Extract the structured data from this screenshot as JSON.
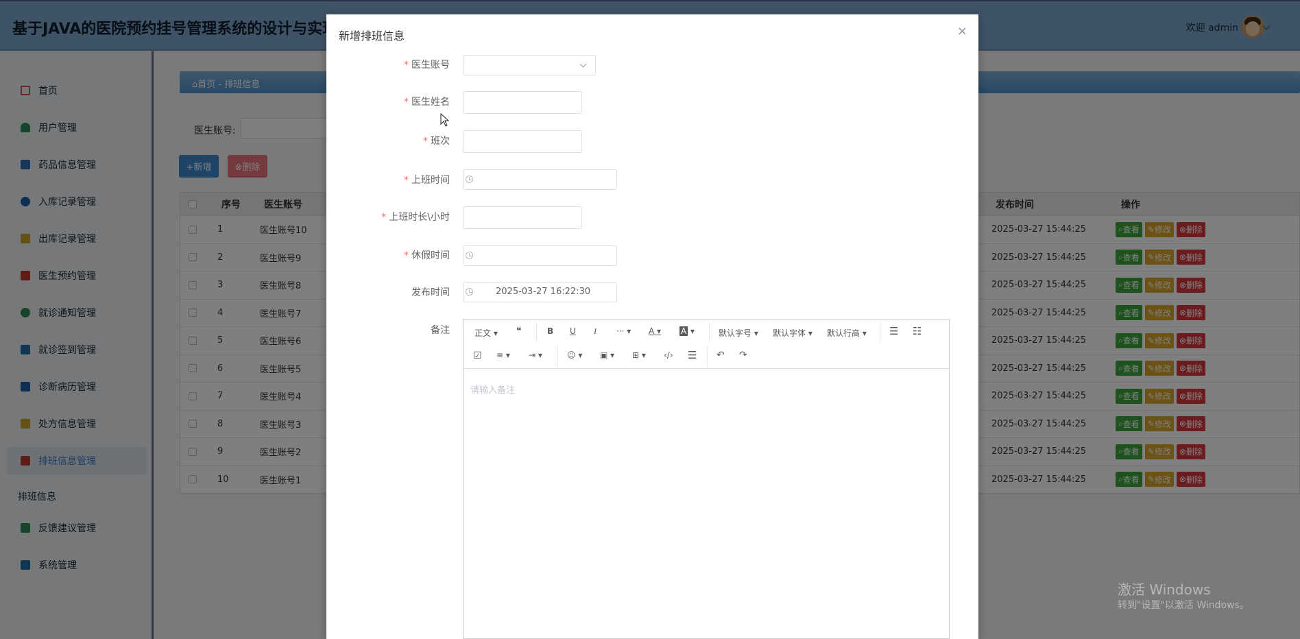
{
  "app": {
    "title": "基于JAVA的医院预约挂号管理系统的设计与实现",
    "welcome": "欢迎 admin"
  },
  "sidebar": {
    "items": [
      {
        "label": "首页",
        "icon": "home-icon",
        "color": "#d9534f"
      },
      {
        "label": "用户管理",
        "icon": "user-icon",
        "color": "#2e8b57"
      },
      {
        "label": "药品信息管理",
        "icon": "medicine-icon",
        "color": "#2a6fb0"
      },
      {
        "label": "入库记录管理",
        "icon": "stock-in-icon",
        "color": "#1f5fa8"
      },
      {
        "label": "出库记录管理",
        "icon": "stock-out-icon",
        "color": "#c9a227"
      },
      {
        "label": "医生预约管理",
        "icon": "appointment-icon",
        "color": "#c0392b"
      },
      {
        "label": "就诊通知管理",
        "icon": "notice-icon",
        "color": "#2e8b57"
      },
      {
        "label": "就诊签到管理",
        "icon": "checkin-icon",
        "color": "#1f6fa8"
      },
      {
        "label": "诊断病历管理",
        "icon": "record-icon",
        "color": "#1f5fa8"
      },
      {
        "label": "处方信息管理",
        "icon": "prescription-icon",
        "color": "#c9a227"
      },
      {
        "label": "排班信息管理",
        "icon": "schedule-icon",
        "color": "#c0392b"
      },
      {
        "label": "反馈建议管理",
        "icon": "feedback-icon",
        "color": "#2e8b57"
      },
      {
        "label": "系统管理",
        "icon": "system-icon",
        "color": "#1f6fa8"
      }
    ],
    "sub_label": "排班信息"
  },
  "main": {
    "breadcrumb": "⌂首页 - 排班信息",
    "search_label": "医生账号:",
    "add_button": "+新增",
    "delete_button": "⊗删除",
    "columns": [
      "序号",
      "医生账号",
      "发布时间",
      "操作"
    ],
    "rows": [
      {
        "no": "1",
        "account": "医生账号10",
        "time": "2025-03-27 15:44:25"
      },
      {
        "no": "2",
        "account": "医生账号9",
        "time": "2025-03-27 15:44:25"
      },
      {
        "no": "3",
        "account": "医生账号8",
        "time": "2025-03-27 15:44:25"
      },
      {
        "no": "4",
        "account": "医生账号7",
        "time": "2025-03-27 15:44:25"
      },
      {
        "no": "5",
        "account": "医生账号6",
        "time": "2025-03-27 15:44:25"
      },
      {
        "no": "6",
        "account": "医生账号5",
        "time": "2025-03-27 15:44:25"
      },
      {
        "no": "7",
        "account": "医生账号4",
        "time": "2025-03-27 15:44:25"
      },
      {
        "no": "8",
        "account": "医生账号3",
        "time": "2025-03-27 15:44:25"
      },
      {
        "no": "9",
        "account": "医生账号2",
        "time": "2025-03-27 15:44:25"
      },
      {
        "no": "10",
        "account": "医生账号1",
        "time": "2025-03-27 15:44:25"
      }
    ],
    "actions": {
      "view": "查看",
      "edit": "修改",
      "delete": "删除"
    }
  },
  "modal": {
    "title": "新增排班信息",
    "close": "×",
    "fields": {
      "doctor_account": "医生账号",
      "doctor_name": "医生姓名",
      "shift": "班次",
      "work_time": "上班时间",
      "work_hours": "上班时长\\小时",
      "leave_time": "休假时间",
      "publish_time": "发布时间",
      "remark": "备注"
    },
    "publish_time_value": "2025-03-27 16:22:30",
    "editor": {
      "paragraph": "正文",
      "quote": "❝",
      "bold": "B",
      "underline": "U",
      "italic": "I",
      "more": "···",
      "font_color": "A",
      "bg_color": "A",
      "font_size": "默认字号",
      "font_family": "默认字体",
      "line_height": "默认行高",
      "placeholder": "请输入备注"
    }
  },
  "watermark": {
    "line1": "激活 Windows",
    "line2": "转到\"设置\"以激活 Windows。"
  }
}
